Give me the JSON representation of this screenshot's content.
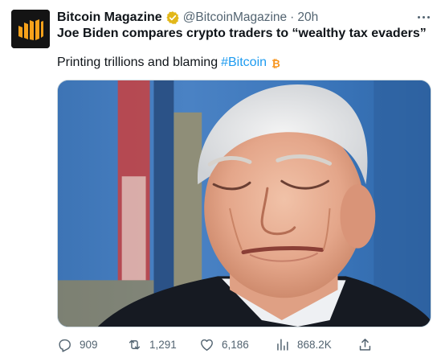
{
  "account": {
    "display_name": "Bitcoin Magazine",
    "handle": "@BitcoinMagazine",
    "separator": "·",
    "time": "20h",
    "avatar_icon": "bitcoin-magazine-logo",
    "verified_icon": "gold-verified-badge-icon",
    "verified_color": "#e2b719"
  },
  "tweet": {
    "headline": "Joe Biden compares crypto traders to “wealthy tax evaders”",
    "text": "Printing trillions and blaming",
    "hashtag": "#Bitcoin",
    "trailing_icon": "bitcoin-icon",
    "image_icon": "photo-of-man-with-eyes-closed"
  },
  "actions": {
    "reply": {
      "icon": "reply-icon",
      "count": "909"
    },
    "retweet": {
      "icon": "retweet-icon",
      "count": "1,291"
    },
    "like": {
      "icon": "heart-icon",
      "count": "6,186"
    },
    "views": {
      "icon": "views-chart-icon",
      "count": "868.2K"
    },
    "share": {
      "icon": "share-icon"
    }
  },
  "colors": {
    "link": "#1d9bf0",
    "muted": "#536471",
    "text": "#0f1419",
    "bitcoin_orange": "#f7931a"
  }
}
